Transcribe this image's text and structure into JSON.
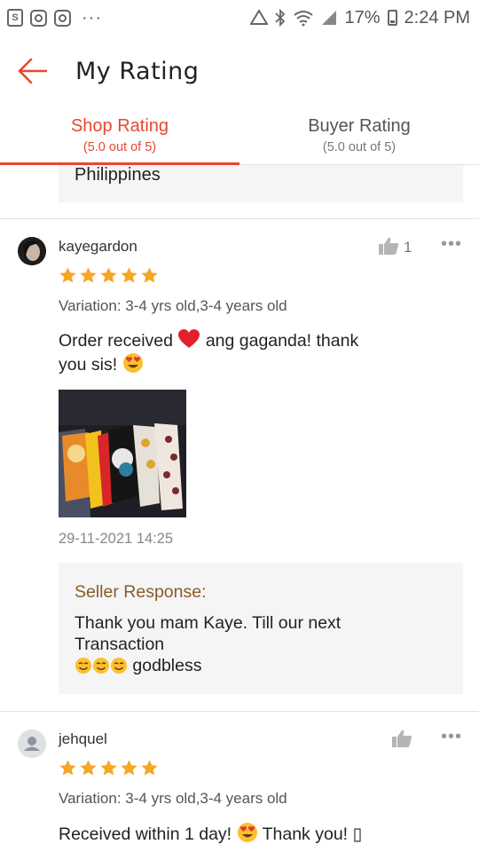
{
  "status_bar": {
    "battery": "17%",
    "time": "2:24 PM",
    "dots": "···"
  },
  "header": {
    "title": "My Rating"
  },
  "tabs": [
    {
      "label": "Shop Rating",
      "sub": "(5.0 out of 5)",
      "active": true
    },
    {
      "label": "Buyer Rating",
      "sub": "(5.0 out of 5)",
      "active": false
    }
  ],
  "previous_card": {
    "text": "Philippines"
  },
  "reviews": [
    {
      "username": "kayegardon",
      "stars": 5,
      "variation": "Variation: 3-4 yrs old,3-4 years old",
      "comment_part1": "Order received",
      "comment_part2": "ang gaganda! thank",
      "comment_part3": "you sis!",
      "likes": "1",
      "date": "29-11-2021 14:25",
      "seller_response_title": "Seller Response:",
      "seller_response_line1": "Thank you mam Kaye. Till our next",
      "seller_response_line2": "Transaction",
      "seller_response_line3": "godbless"
    },
    {
      "username": "jehquel",
      "stars": 5,
      "variation": "Variation: 3-4 yrs old,3-4 years old",
      "comment_part1": "Received within 1 day!",
      "comment_part2": "Thank you! ▯"
    }
  ],
  "colors": {
    "accent": "#e4492e",
    "star": "#f6a623",
    "seller_title": "#8a5a2b"
  }
}
